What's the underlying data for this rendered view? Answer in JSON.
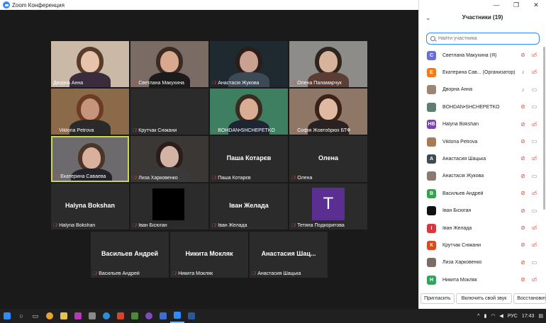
{
  "window": {
    "title": "Zoom Конференция"
  },
  "tiles": [
    {
      "name": "Дворна Анна",
      "muted": false,
      "kind": "video",
      "bg": "#cbb9a8",
      "skin": "#e7c3ab",
      "hair": "#5a3b2a",
      "shirt": "#3a2c3c"
    },
    {
      "name": "Светлана Макухина",
      "muted": true,
      "kind": "video",
      "bg": "#7a6c65",
      "skin": "#d9a98f",
      "hair": "#3a2a22",
      "shirt": "#1b1b1b"
    },
    {
      "name": "Анастасія Жукова",
      "muted": true,
      "kind": "video",
      "bg": "#1f2a30",
      "skin": "#caa090",
      "hair": "#2a1e1a",
      "shirt": "#3b4a55"
    },
    {
      "name": "Олена Паламарчук",
      "muted": true,
      "kind": "video",
      "bg": "#8d8c89",
      "skin": "#d6b39b",
      "hair": "#2e251f",
      "shirt": "#5b3d33"
    },
    {
      "name": "Viktoria Petrova",
      "muted": true,
      "kind": "video",
      "bg": "#8a6a48",
      "skin": "#c6947b",
      "hair": "#6b3b26",
      "shirt": "#2a2a2a"
    },
    {
      "name": "Крутчак Сніжани",
      "muted": true,
      "kind": "blank"
    },
    {
      "name": "BOHDAN•SHCHEPETKO",
      "muted": true,
      "kind": "video",
      "bg": "#3e7f61",
      "skin": "#d7ad93",
      "hair": "#3a2b22",
      "shirt": "#1e2530"
    },
    {
      "name": "Софія Жовтобрюх БТФ",
      "muted": true,
      "kind": "video",
      "bg": "#8e7767",
      "skin": "#e0b9a3",
      "hair": "#3b2219",
      "shirt": "#2a2222"
    },
    {
      "name": "Екатерина Саваева",
      "muted": true,
      "kind": "video",
      "active": true,
      "bg": "#6c6a6c",
      "skin": "#d8b09b",
      "hair": "#4a3528",
      "shirt": "#25232a"
    },
    {
      "name": "Лиза Харковенко",
      "muted": true,
      "kind": "video",
      "bg": "#3b3734",
      "skin": "#d3b3a3",
      "hair": "#2b1e1a",
      "shirt": "#3a3a3a"
    },
    {
      "name": "Паша Котарєв",
      "muted": true,
      "kind": "name",
      "big": "Паша Котарєв"
    },
    {
      "name": "Олена",
      "muted": true,
      "kind": "name",
      "big": "Олена"
    },
    {
      "name": "Halyna Bokshan",
      "muted": true,
      "kind": "name",
      "big": "Halyna Bokshan"
    },
    {
      "name": "Іван Бісюган",
      "muted": true,
      "kind": "black"
    },
    {
      "name": "Іван Желада",
      "muted": true,
      "kind": "name",
      "big": "Іван Желада"
    },
    {
      "name": "Тетяна Подкоритова",
      "muted": true,
      "kind": "avatar",
      "letter": "T"
    },
    {
      "name": "Васильев Андрей",
      "muted": true,
      "kind": "name",
      "big": "Васильев Андрей"
    },
    {
      "name": "Никита Мокляк",
      "muted": true,
      "kind": "name",
      "big": "Никита Мокляк"
    },
    {
      "name": "Анастасия Шацька",
      "muted": true,
      "kind": "name",
      "big": "Анастасия Шац..."
    }
  ],
  "panel": {
    "title": "Участники (19)",
    "search_placeholder": "Найти участника",
    "participants": [
      {
        "name": "Светлана Макухина (Я)",
        "initial": "С",
        "color": "#6a6fd6",
        "mic": "off",
        "cam": "off"
      },
      {
        "name": "Екатерина Сав... (Организатор)",
        "initial": "Е",
        "color": "#f07c20",
        "mic": "on",
        "cam": "off"
      },
      {
        "name": "Дворна Анна",
        "initial": "",
        "color": "#9b8577",
        "mic": "on",
        "cam": "on"
      },
      {
        "name": "BOHDAN•SHCHEPETKO",
        "initial": "",
        "color": "#5d7f74",
        "mic": "off",
        "cam": "on"
      },
      {
        "name": "Halyna Bokshan",
        "initial": "HB",
        "color": "#7b3fbf",
        "mic": "off",
        "cam": "off"
      },
      {
        "name": "Viktoria Petrova",
        "initial": "",
        "color": "#a57b5a",
        "mic": "off",
        "cam": "on"
      },
      {
        "name": "Анастасия Шацька",
        "initial": "А",
        "color": "#3f4a55",
        "mic": "off",
        "cam": "off"
      },
      {
        "name": "Анастасія Жукова",
        "initial": "",
        "color": "#8a7a70",
        "mic": "off",
        "cam": "on"
      },
      {
        "name": "Васильев Андрей",
        "initial": "В",
        "color": "#2fa64a",
        "mic": "off",
        "cam": "off"
      },
      {
        "name": "Іван Бісюган",
        "initial": "",
        "color": "#111111",
        "mic": "off",
        "cam": "on"
      },
      {
        "name": "Іван Желада",
        "initial": "І",
        "color": "#d9363e",
        "mic": "off",
        "cam": "off"
      },
      {
        "name": "Крутчак Сніжани",
        "initial": "К",
        "color": "#d94a1e",
        "mic": "off",
        "cam": "off"
      },
      {
        "name": "Лиза Харковенко",
        "initial": "",
        "color": "#7a6d66",
        "mic": "off",
        "cam": "on"
      },
      {
        "name": "Никита Мокляк",
        "initial": "Н",
        "color": "#2ba75a",
        "mic": "off",
        "cam": "off"
      }
    ],
    "footer": {
      "invite": "Пригласить",
      "unmute": "Включить свой звук",
      "restore": "Восстановит"
    }
  },
  "taskbar": {
    "lang": "РУС",
    "time": "17:43"
  },
  "colors": {
    "accent": "#2d8cff",
    "muted_red": "#e5413b",
    "active_border": "#c9d94a"
  }
}
